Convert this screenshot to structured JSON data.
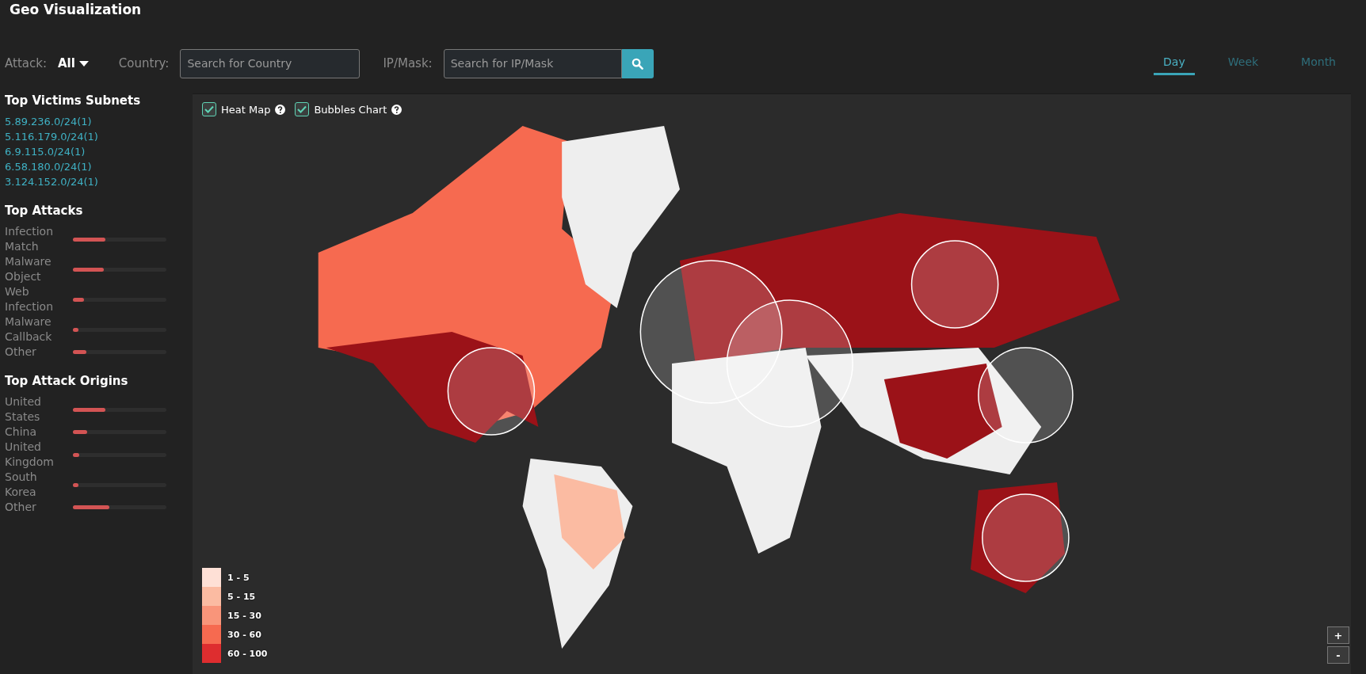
{
  "title": "Geo Visualization",
  "filters": {
    "attack_label": "Attack:",
    "attack_value": "All",
    "country_label": "Country:",
    "country_placeholder": "Search for Country",
    "ip_label": "IP/Mask:",
    "ip_placeholder": "Search for IP/Mask"
  },
  "period_tabs": [
    {
      "label": "Day",
      "selected": true
    },
    {
      "label": "Week",
      "selected": false
    },
    {
      "label": "Month",
      "selected": false
    }
  ],
  "victim_subnets": {
    "heading": "Top Victims Subnets",
    "items": [
      "5.89.236.0/24(1)",
      "5.116.179.0/24(1)",
      "6.9.115.0/24(1)",
      "6.58.180.0/24(1)",
      "3.124.152.0/24(1)"
    ]
  },
  "top_attacks": {
    "heading": "Top Attacks",
    "items": [
      {
        "name": "Infection Match",
        "level": 0.35
      },
      {
        "name": "Malware Object",
        "level": 0.33
      },
      {
        "name": "Web Infection",
        "level": 0.12
      },
      {
        "name": "Malware Callback",
        "level": 0.06
      },
      {
        "name": "Other",
        "level": 0.14
      }
    ]
  },
  "top_origins": {
    "heading": "Top Attack Origins",
    "items": [
      {
        "name": "United States",
        "level": 0.35
      },
      {
        "name": "China",
        "level": 0.15
      },
      {
        "name": "United Kingdom",
        "level": 0.07
      },
      {
        "name": "South Korea",
        "level": 0.06
      },
      {
        "name": "Other",
        "level": 0.39
      }
    ]
  },
  "map": {
    "kind": "picture",
    "layers": [
      {
        "label": "Heat Map",
        "checked": true
      },
      {
        "label": "Bubbles Chart",
        "checked": true
      }
    ],
    "legend": [
      {
        "label": "1 - 5",
        "color": "#fee0d6"
      },
      {
        "label": "5 - 15",
        "color": "#fbbba2"
      },
      {
        "label": "15 - 30",
        "color": "#f9957a"
      },
      {
        "label": "30 - 60",
        "color": "#f66a50"
      },
      {
        "label": "60 - 100",
        "color": "#de2d2f"
      }
    ],
    "zoom_in": "+",
    "zoom_out": "-"
  }
}
